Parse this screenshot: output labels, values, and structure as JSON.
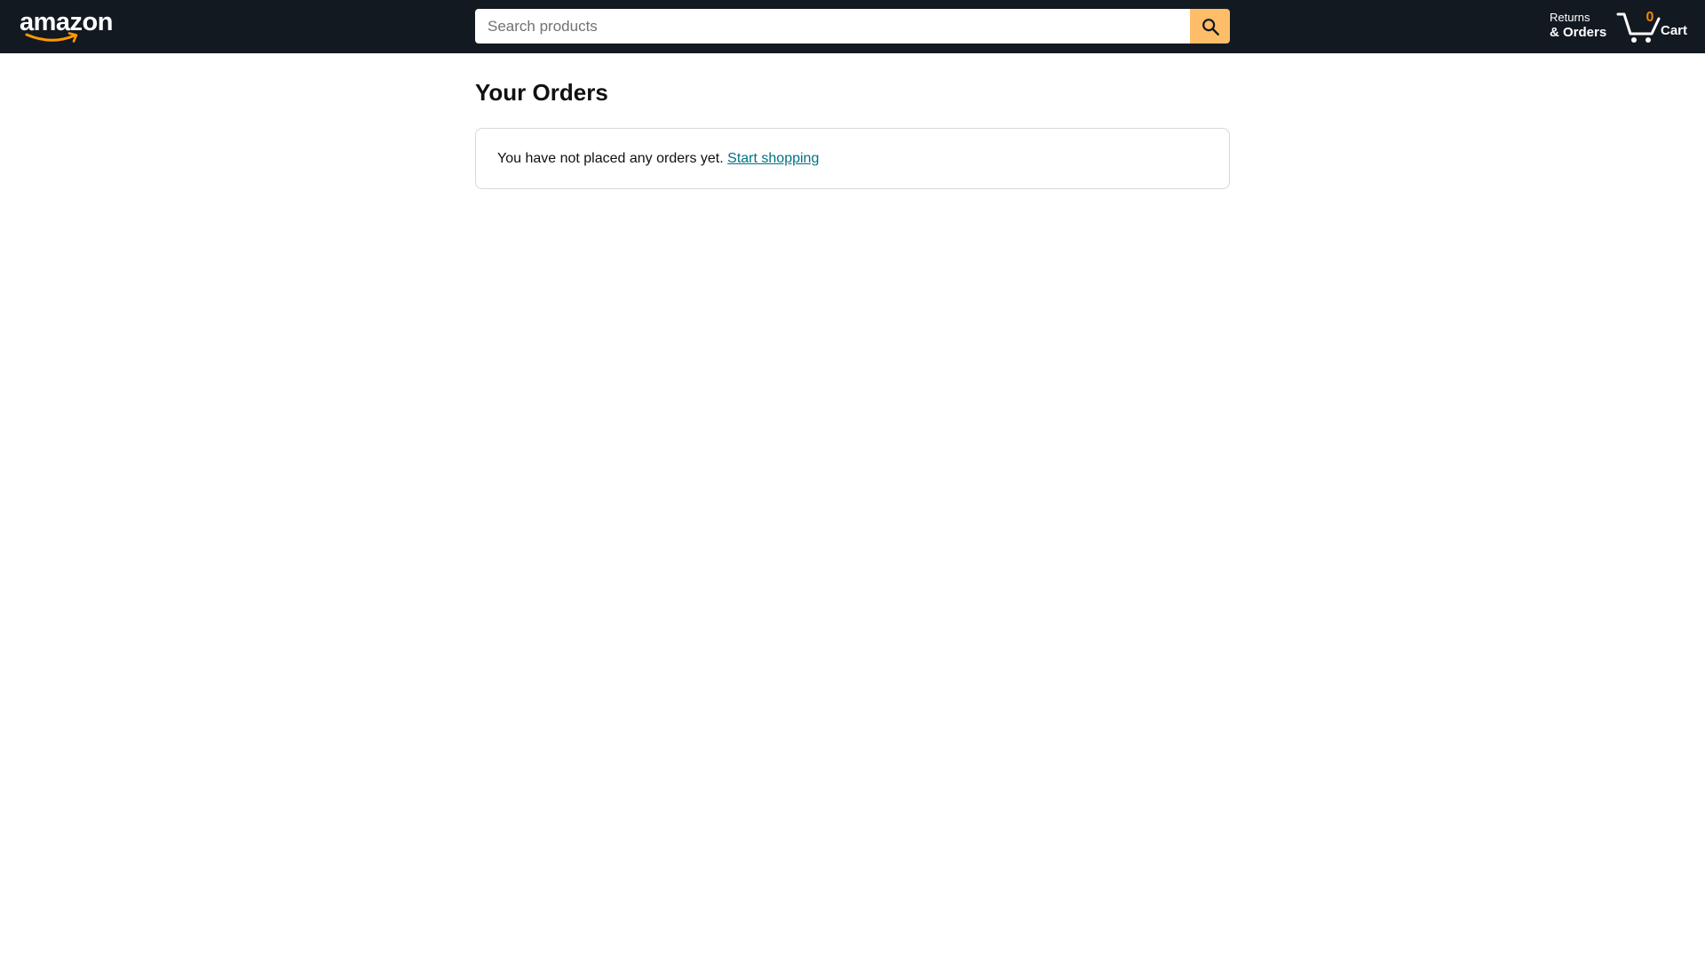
{
  "nav": {
    "logo_text": "amazon",
    "logo_accent_color": "#ff9900",
    "background_color": "#131921",
    "search": {
      "placeholder": "Search products",
      "value": "",
      "button_icon": "search-icon",
      "button_color": "#febd69"
    },
    "returns": {
      "line1": "Returns",
      "line2": "& Orders"
    },
    "cart": {
      "icon": "cart-icon",
      "count": "0",
      "count_color": "#f08804",
      "label": "Cart"
    }
  },
  "main": {
    "title": "Your Orders",
    "empty_state": {
      "message": "You have not placed any orders yet.",
      "link_label": "Start shopping",
      "link_color": "#007185"
    }
  }
}
